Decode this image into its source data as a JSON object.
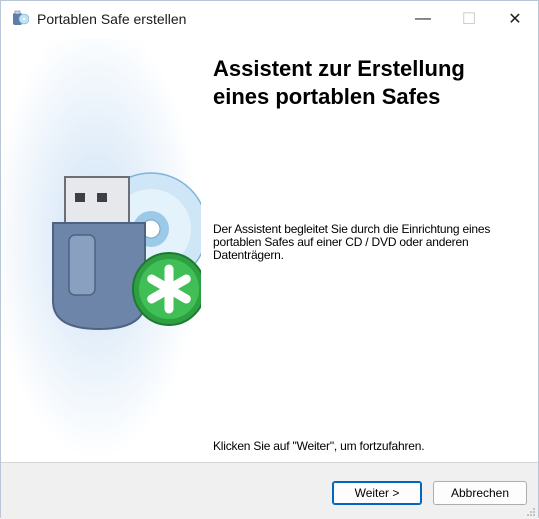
{
  "window": {
    "title": "Portablen Safe erstellen",
    "controls": {
      "minimize": "—",
      "maximize": "☐",
      "close": "✕"
    }
  },
  "wizard": {
    "heading": "Assistent zur Erstellung eines portablen Safes",
    "description": "Der Assistent begleitet Sie durch die Einrichtung eines portablen Safes auf einer CD / DVD oder anderen Datenträgern.",
    "hint": "Klicken Sie auf \"Weiter\", um fortzufahren.",
    "side_image_icons": [
      "usb-drive-icon",
      "cd-disc-icon",
      "asterisk-badge-icon"
    ]
  },
  "buttons": {
    "next": "Weiter >",
    "cancel": "Abbrechen"
  },
  "colors": {
    "accent": "#0067c0",
    "footer": "#f0f0f0",
    "badge_green": "#2ea043"
  }
}
